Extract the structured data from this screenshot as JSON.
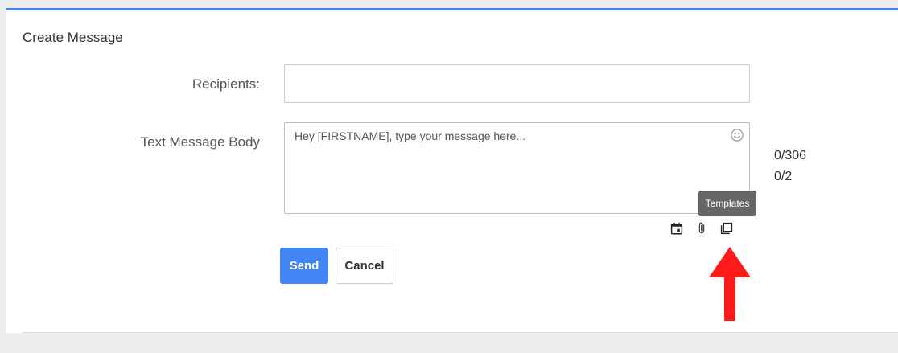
{
  "header": {
    "title": "Create Message"
  },
  "form": {
    "recipients_label": "Recipients:",
    "recipients_value": "",
    "body_label": "Text Message Body",
    "body_placeholder": "Hey [FIRSTNAME], type your message here...",
    "char_count": "0/306",
    "segment_count": "0/2"
  },
  "toolbar": {
    "icons": [
      "calendar-icon",
      "paperclip-icon",
      "templates-icon"
    ],
    "tooltip": "Templates"
  },
  "actions": {
    "send_label": "Send",
    "cancel_label": "Cancel"
  },
  "colors": {
    "accent": "#4285f4",
    "arrow": "#ff1a1a",
    "tooltip_bg": "#666666"
  }
}
